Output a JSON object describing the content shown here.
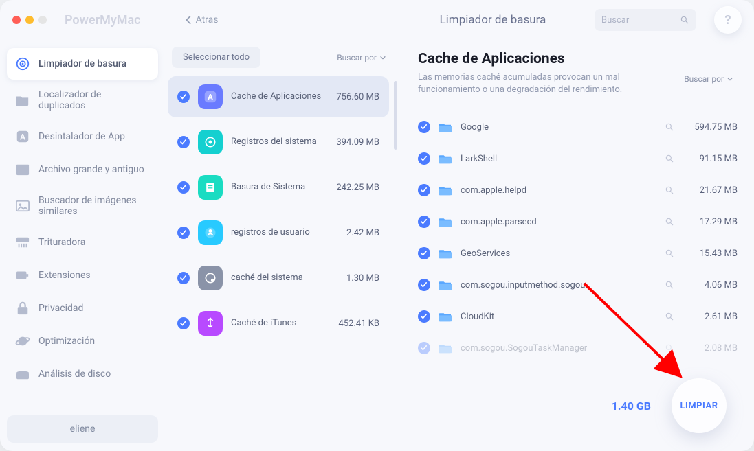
{
  "app": {
    "name": "PowerMyMac",
    "back": "Atras",
    "header_title": "Limpiador de basura"
  },
  "search": {
    "placeholder": "Buscar"
  },
  "help": {
    "label": "?"
  },
  "sidebar": {
    "items": [
      {
        "label": "Limpiador de basura"
      },
      {
        "label": "Localizador de duplicados"
      },
      {
        "label": "Desintalador de App"
      },
      {
        "label": "Archivo grande y antiguo"
      },
      {
        "label": "Buscador de imágenes similares"
      },
      {
        "label": "Trituradora"
      },
      {
        "label": "Extensiones"
      },
      {
        "label": "Privacidad"
      },
      {
        "label": "Optimización"
      },
      {
        "label": "Análisis de disco"
      }
    ],
    "user": "eliene"
  },
  "middle": {
    "select_all": "Seleccionar todo",
    "sort_by": "Buscar por",
    "categories": [
      {
        "label": "Cache de Aplicaciones",
        "size": "756.60 MB",
        "color": "#6a7bff"
      },
      {
        "label": "Registros del sistema",
        "size": "394.09 MB",
        "color": "#14d0d0"
      },
      {
        "label": "Basura de Sistema",
        "size": "242.25 MB",
        "color": "#1adcc2"
      },
      {
        "label": "registros de usuario",
        "size": "2.42 MB",
        "color": "#28caff"
      },
      {
        "label": "caché del sistema",
        "size": "1.30 MB",
        "color": "#8a93a8"
      },
      {
        "label": "Caché de iTunes",
        "size": "452.41 KB",
        "color": "#b84aff"
      }
    ]
  },
  "detail": {
    "title": "Cache de Aplicaciones",
    "desc": "Las memorias caché acumuladas provocan un mal funcionamiento o una degradación del rendimiento.",
    "sort_by": "Buscar por",
    "files": [
      {
        "name": "Google",
        "size": "594.75 MB"
      },
      {
        "name": "LarkShell",
        "size": "91.15 MB"
      },
      {
        "name": "com.apple.helpd",
        "size": "21.67 MB"
      },
      {
        "name": "com.apple.parsecd",
        "size": "17.29 MB"
      },
      {
        "name": "GeoServices",
        "size": "15.43 MB"
      },
      {
        "name": "com.sogou.inputmethod.sogou",
        "size": "4.06 MB"
      },
      {
        "name": "CloudKit",
        "size": "2.61 MB"
      },
      {
        "name": "com.sogou.SogouTaskManager",
        "size": "2.08 MB"
      }
    ]
  },
  "footer": {
    "total": "1.40 GB",
    "button": "LIMPIAR"
  }
}
